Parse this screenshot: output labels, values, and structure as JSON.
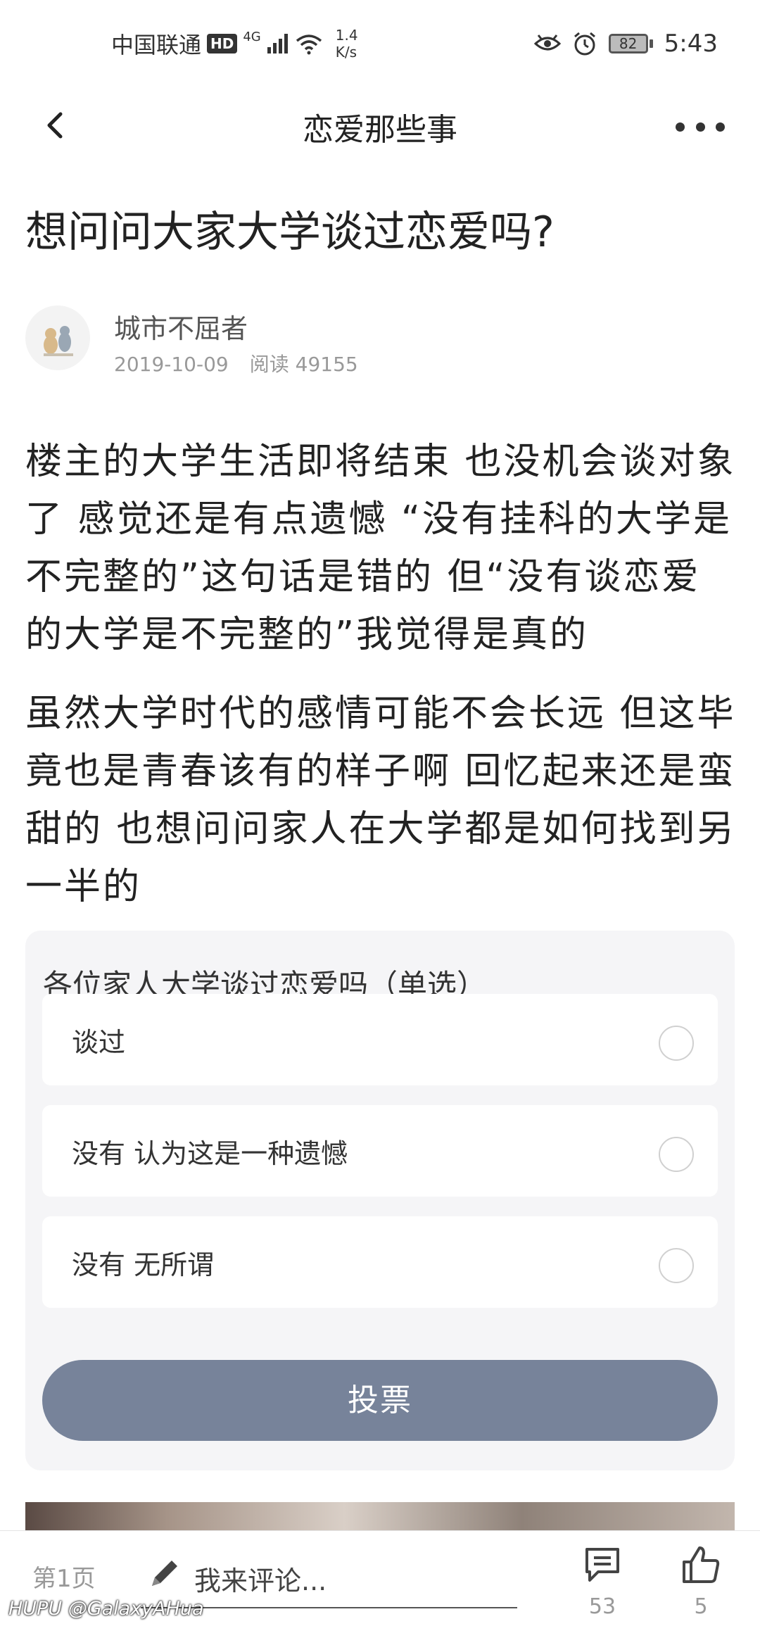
{
  "status_bar": {
    "carrier": "中国联通",
    "hd": "HD",
    "network": "4G",
    "speed_value": "1.4",
    "speed_unit": "K/s",
    "battery": "82",
    "time": "5:43"
  },
  "nav": {
    "title": "恋爱那些事"
  },
  "post": {
    "title": "想问问大家大学谈过恋爱吗?",
    "author": "城市不屈者",
    "date": "2019-10-09",
    "reads": "阅读 49155",
    "paragraphs": [
      "楼主的大学生活即将结束 也没机会谈对象了 感觉还是有点遗憾 “没有挂科的大学是不完整的”这句话是错的 但“没有谈恋爱的大学是不完整的”我觉得是真的",
      "虽然大学时代的感情可能不会长远 但这毕竟也是青春该有的样子啊 回忆起来还是蛮甜的 也想问问家人在大学都是如何找到另一半的"
    ]
  },
  "poll": {
    "title": "各位家人大学谈过恋爱吗（单选）",
    "options": [
      {
        "label": "谈过"
      },
      {
        "label": "没有 认为这是一种遗憾"
      },
      {
        "label": "没有 无所谓"
      }
    ],
    "vote_label": "投票"
  },
  "bottom_bar": {
    "page_label": "第1页",
    "comment_placeholder": "我来评论...",
    "comment_count": "53",
    "like_count": "5",
    "watermark": "HUPU @GalaxyAHua"
  },
  "colors": {
    "vote_button": "#77839a",
    "poll_background": "#f5f5f7"
  },
  "icons": [
    "back-arrow-icon",
    "more-dots-icon",
    "pencil-icon",
    "comment-icon",
    "thumbs-up-icon",
    "eye-icon",
    "alarm-icon",
    "wifi-icon",
    "signal-icon"
  ]
}
